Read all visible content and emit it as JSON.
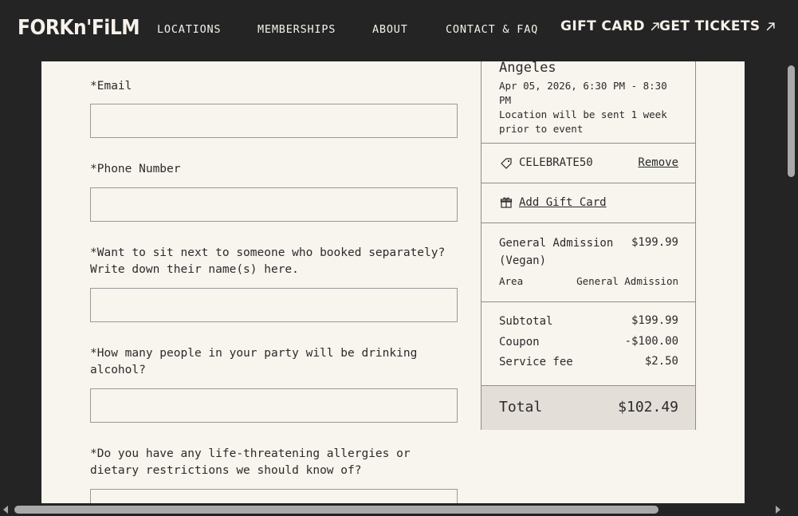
{
  "header": {
    "logo_text": "FORKn'FiLM",
    "nav": [
      "LOCATIONS",
      "MEMBERSHIPS",
      "ABOUT",
      "CONTACT & FAQ"
    ],
    "gift_card": "GIFT CARD",
    "get_tickets": "GET TICKETS"
  },
  "form": {
    "fields": [
      {
        "label": "*Email",
        "value": ""
      },
      {
        "label": "*Phone Number",
        "value": ""
      },
      {
        "label": "*Want to sit next to someone who booked separately? Write down their name(s) here.",
        "value": ""
      },
      {
        "label": "*How many people in your party will be drinking alcohol?",
        "value": ""
      },
      {
        "label": "*Do you have any life-threatening allergies or dietary restrictions we should know of?",
        "value": ""
      }
    ]
  },
  "summary": {
    "event_city": "Angeles",
    "event_datetime": "Apr 05, 2026, 6:30 PM - 8:30 PM",
    "location_note": "Location will be sent 1 week prior to event",
    "coupon_code": "CELEBRATE50",
    "remove_label": "Remove",
    "add_gift_card_label": "Add Gift Card",
    "ticket": {
      "name": "General Admission (Vegan)",
      "price": "$199.99",
      "area_label": "Area",
      "area_value": "General Admission"
    },
    "subtotal_label": "Subtotal",
    "subtotal_value": "$199.99",
    "coupon_label": "Coupon",
    "coupon_value": "-$100.00",
    "service_fee_label": "Service fee",
    "service_fee_value": "$2.50",
    "total_label": "Total",
    "total_value": "$102.49"
  },
  "icons": {
    "tag": "tag-icon",
    "gift": "gift-icon",
    "arrow": "arrow-up-right-icon"
  }
}
